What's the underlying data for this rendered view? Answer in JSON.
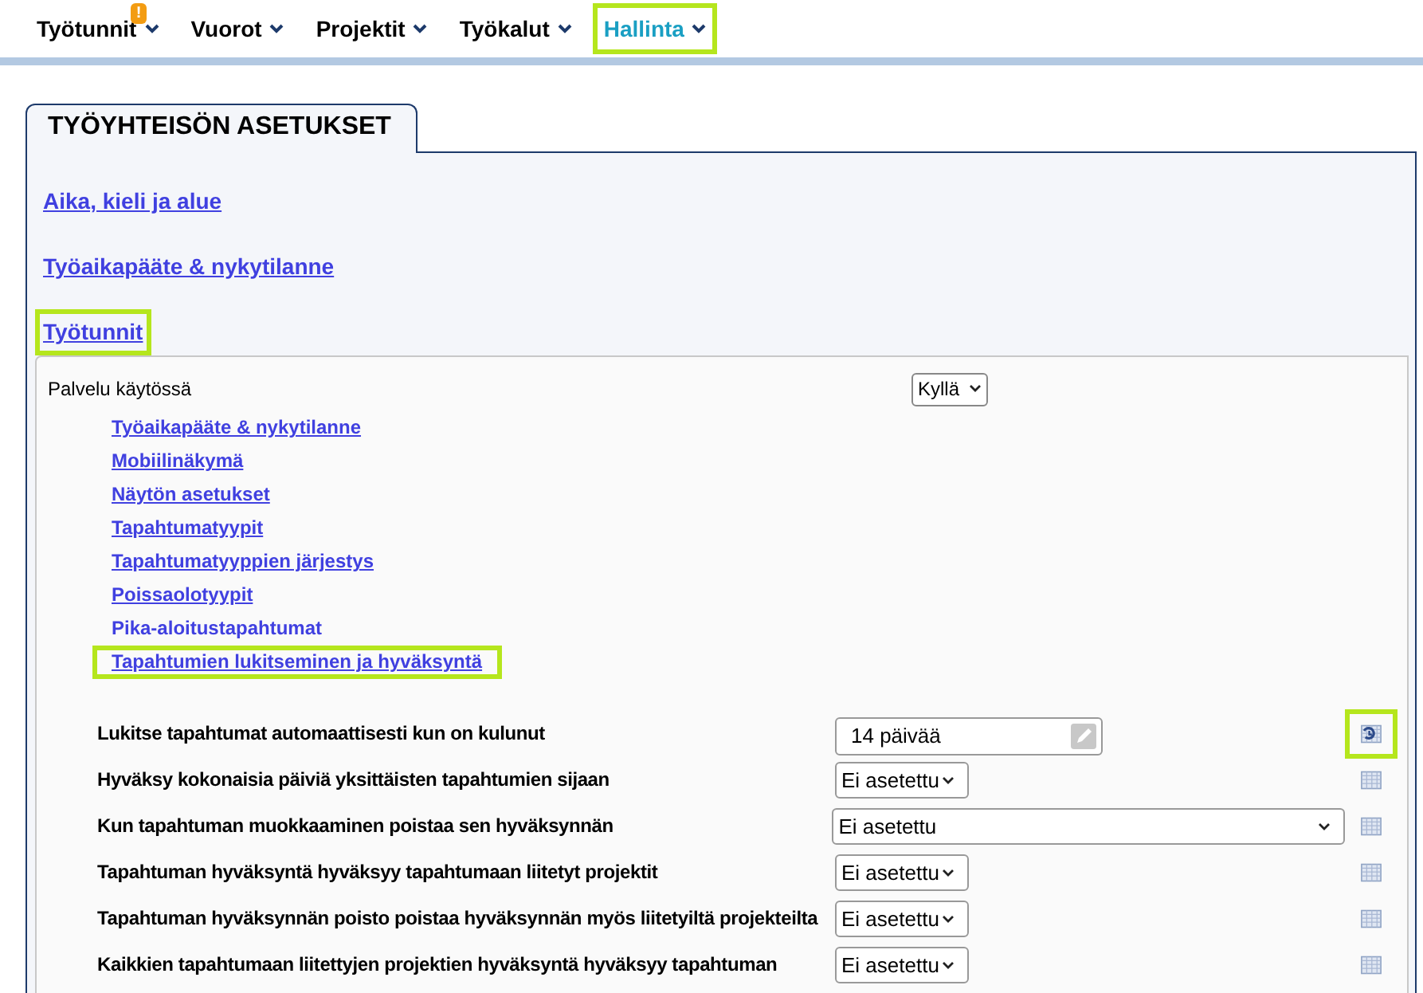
{
  "nav": [
    {
      "label": "Työtunnit",
      "alert": "!",
      "selected": false,
      "highlighted": false
    },
    {
      "label": "Vuorot",
      "selected": false,
      "highlighted": false
    },
    {
      "label": "Projektit",
      "selected": false,
      "highlighted": false
    },
    {
      "label": "Työkalut",
      "selected": false,
      "highlighted": false
    },
    {
      "label": "Hallinta",
      "selected": true,
      "highlighted": true
    }
  ],
  "panel": {
    "tab": "TYÖYHTEISÖN ASETUKSET",
    "sections": [
      {
        "label": "Aika, kieli ja alue",
        "highlighted": false
      },
      {
        "label": "Työaikapääte & nykytilanne",
        "highlighted": false
      },
      {
        "label": "Työtunnit",
        "highlighted": true
      }
    ],
    "service": {
      "label": "Palvelu käytössä",
      "value": "Kyllä"
    },
    "links": [
      {
        "label": "Työaikapääte & nykytilanne",
        "underlined": true,
        "highlighted": false
      },
      {
        "label": "Mobiilinäkymä",
        "underlined": true,
        "highlighted": false
      },
      {
        "label": "Näytön asetukset",
        "underlined": true,
        "highlighted": false
      },
      {
        "label": "Tapahtumatyypit",
        "underlined": true,
        "highlighted": false
      },
      {
        "label": "Tapahtumatyyppien järjestys",
        "underlined": true,
        "highlighted": false
      },
      {
        "label": "Poissaolotyypit",
        "underlined": true,
        "highlighted": false
      },
      {
        "label": "Pika-aloitustapahtumat",
        "underlined": false,
        "highlighted": false
      },
      {
        "label": "Tapahtumien lukitseminen ja hyväksyntä",
        "underlined": true,
        "highlighted": true
      }
    ],
    "settings": [
      {
        "label": "Lukitse tapahtumat automaattisesti kun on kulunut",
        "kind": "text",
        "value": "14 päivää",
        "highlighted": true
      },
      {
        "label": "Hyväksy kokonaisia päiviä yksittäisten tapahtumien sijaan",
        "kind": "select",
        "wide": false,
        "value": "Ei asetettu",
        "highlighted": false
      },
      {
        "label": "Kun tapahtuman muokkaaminen poistaa sen hyväksynnän",
        "kind": "select",
        "wide": true,
        "value": "Ei asetettu",
        "highlighted": false
      },
      {
        "label": "Tapahtuman hyväksyntä hyväksyy tapahtumaan liitetyt projektit",
        "kind": "select",
        "wide": false,
        "value": "Ei asetettu",
        "highlighted": false
      },
      {
        "label": "Tapahtuman hyväksynnän poisto poistaa hyväksynnän myös liitetyiltä projekteilta",
        "kind": "select",
        "wide": false,
        "value": "Ei asetettu",
        "highlighted": false
      },
      {
        "label": "Kaikkien tapahtumaan liitettyjen projektien hyväksyntä hyväksyy tapahtuman",
        "kind": "select",
        "wide": false,
        "value": "Ei asetettu",
        "highlighted": false
      }
    ]
  }
}
